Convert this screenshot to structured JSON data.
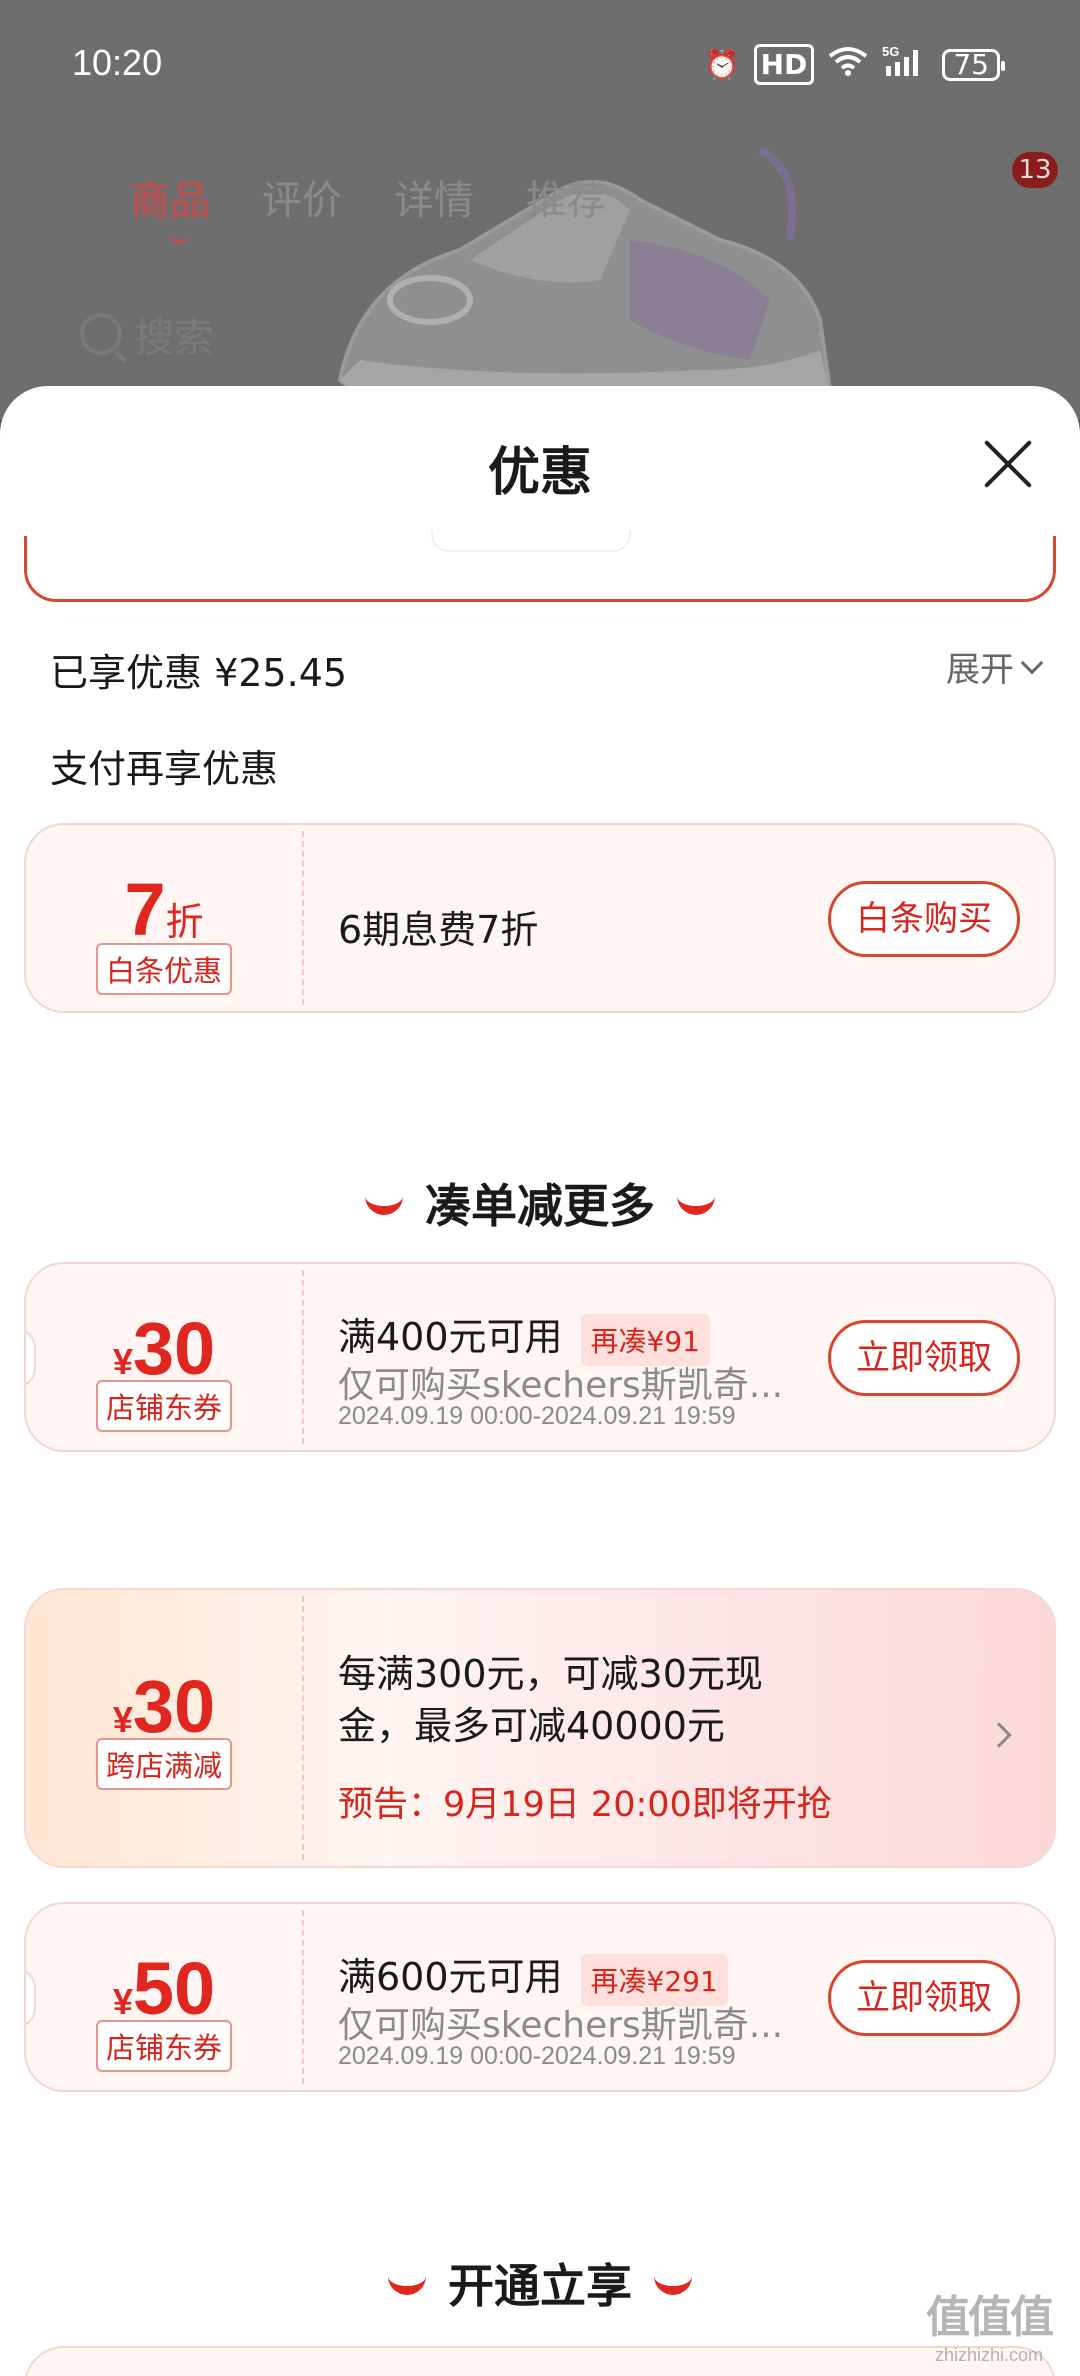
{
  "status_bar": {
    "time": "10:20",
    "hd_label": "HD",
    "network": "5G",
    "battery": "75",
    "icons": [
      "alarm-icon",
      "hd-icon",
      "wifi-icon",
      "signal-icon",
      "battery-icon"
    ]
  },
  "background_page": {
    "tabs": [
      "商品",
      "评价",
      "详情",
      "推荐"
    ],
    "active_tab": "商品",
    "cart_count": "13",
    "search_placeholder": "搜索"
  },
  "sheet": {
    "title": "优惠",
    "enjoyed_label": "已享优惠 ¥25.45",
    "expand_label": "展开",
    "pay_section_title": "支付再享优惠"
  },
  "baitiao_card": {
    "discount_value": "7",
    "discount_unit": "折",
    "tag": "白条优惠",
    "description": "6期息费7折",
    "button": "白条购买"
  },
  "section_more": {
    "title": "凑单减更多"
  },
  "coupon_1": {
    "currency": "¥",
    "amount": "30",
    "tag": "店铺东券",
    "condition": "满400元可用",
    "extra": "再凑¥91",
    "scope": "仅可购买skechers斯凯奇...",
    "validity": "2024.09.19 00:00-2024.09.21 19:59",
    "button": "立即领取"
  },
  "promo_card": {
    "currency": "¥",
    "amount": "30",
    "tag": "跨店满减",
    "line1": "每满300元，可减30元现",
    "line2": "金，最多可减40000元",
    "note": "预告：9月19日 20:00即将开抢"
  },
  "coupon_2": {
    "currency": "¥",
    "amount": "50",
    "tag": "店铺东券",
    "condition": "满600元可用",
    "extra": "再凑¥291",
    "scope": "仅可购买skechers斯凯奇...",
    "validity": "2024.09.19 00:00-2024.09.21 19:59",
    "button": "立即领取"
  },
  "section_open": {
    "title": "开通立享"
  },
  "watermark": {
    "logo": "值值值",
    "url": "zhizhizhi.com"
  },
  "colors": {
    "accent_red": "#e0261f",
    "card_bg": "#fff5f3",
    "overlay": "#6e6e6e"
  }
}
